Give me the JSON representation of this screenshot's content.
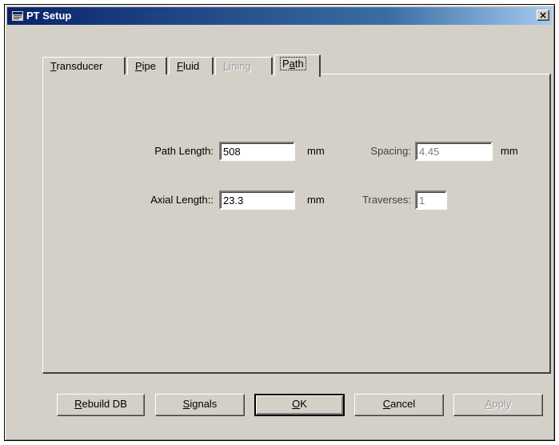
{
  "window": {
    "title": "PT Setup",
    "close_glyph": "×"
  },
  "tabs": [
    {
      "first": "T",
      "rest": "ransducer",
      "state": "normal"
    },
    {
      "first": "P",
      "rest": "ipe",
      "state": "normal"
    },
    {
      "first": "F",
      "rest": "luid",
      "state": "normal"
    },
    {
      "first": "L",
      "rest": "ining",
      "state": "disabled"
    },
    {
      "pre": "P",
      "first": "a",
      "rest": "th",
      "state": "active"
    }
  ],
  "path": {
    "path_length_label": "Path Length:",
    "path_length_value": "508",
    "path_length_unit": "mm",
    "axial_length_label": "Axial Length::",
    "axial_length_value": "23.3",
    "axial_length_unit": "mm",
    "spacing_label": "Spacing:",
    "spacing_value": "4.45",
    "spacing_unit": "mm",
    "traverses_label": "Traverses:",
    "traverses_value": "1"
  },
  "buttons": {
    "rebuild": {
      "first": "R",
      "rest": "ebuild DB"
    },
    "signals": {
      "first": "S",
      "rest": "ignals"
    },
    "ok": {
      "first": "O",
      "rest": "K"
    },
    "cancel": {
      "first": "C",
      "rest": "ancel"
    },
    "apply": {
      "first": "A",
      "rest": "pply"
    }
  }
}
